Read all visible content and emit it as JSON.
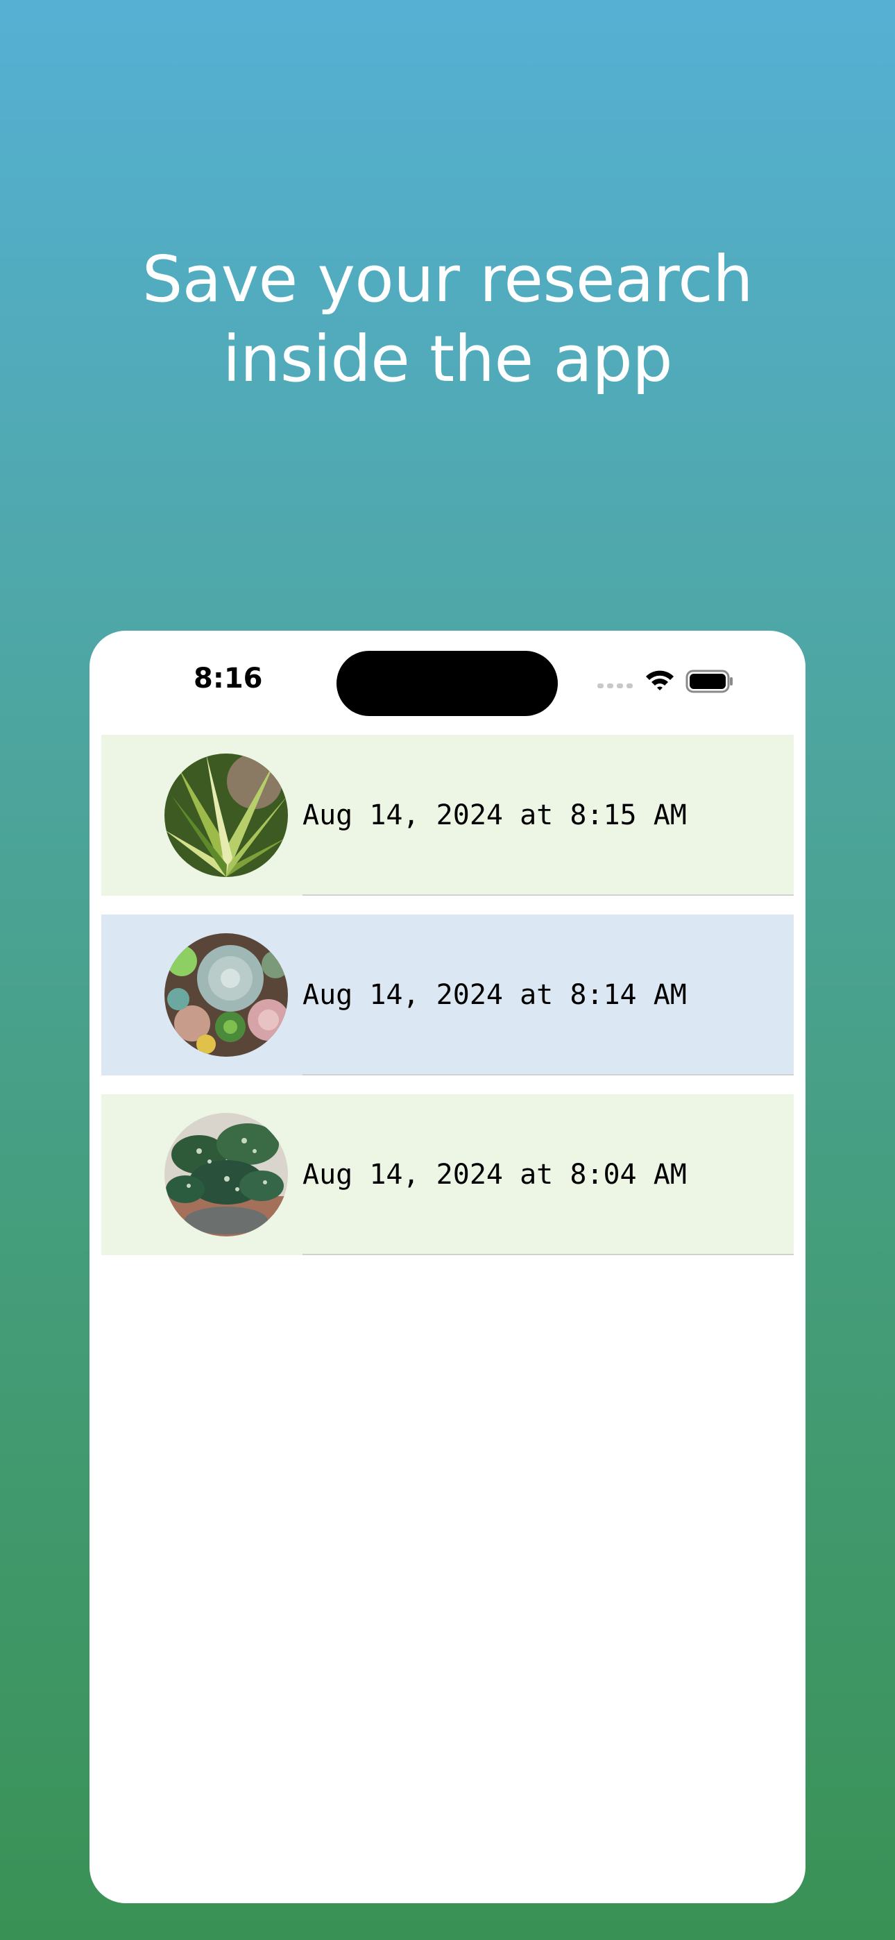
{
  "headline": "Save your research inside the app",
  "status_bar": {
    "time": "8:16",
    "icons": [
      "cellular-signal-icon",
      "wifi-icon",
      "battery-icon"
    ]
  },
  "entries": [
    {
      "timestamp": "Aug 14, 2024 at 8:15 AM",
      "background": "#edf6e4",
      "thumbnail": "spider-plant-photo"
    },
    {
      "timestamp": "Aug 14, 2024 at 8:14 AM",
      "background": "#dbe7f3",
      "thumbnail": "succulent-arrangement-photo"
    },
    {
      "timestamp": "Aug 14, 2024 at 8:04 AM",
      "background": "#edf6e4",
      "thumbnail": "potted-begonia-photo"
    }
  ]
}
